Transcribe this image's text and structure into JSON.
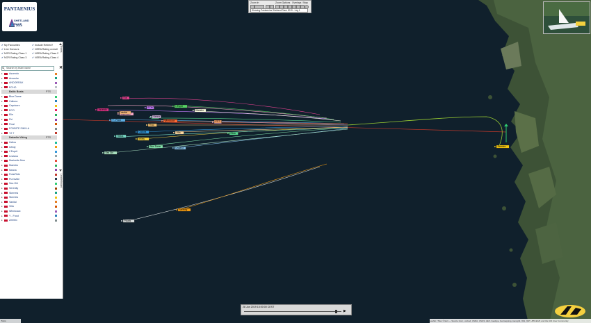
{
  "logo": {
    "brand": "PANTAENIUS",
    "event": "SHETLAND RACE",
    "year": "2019"
  },
  "panel": {
    "options": [
      {
        "label": "My Favourites",
        "checked": true
      },
      {
        "label": "Include Retired?",
        "checked": true
      },
      {
        "label": "Line Honours",
        "checked": true
      },
      {
        "label": "NSRA Rating overall",
        "checked": true
      },
      {
        "label": "NOR Rating Class 1",
        "checked": true
      },
      {
        "label": "NSRA Rating Class 2",
        "checked": true
      },
      {
        "label": "NOR Rating Class 3",
        "checked": true
      },
      {
        "label": "NSRA Rating Class 4",
        "checked": true
      }
    ],
    "search_placeholder": "Search by team name",
    "rows": [
      {
        "name": "Ascendo",
        "group": false,
        "color": "#e67e22"
      },
      {
        "name": "Annecke",
        "group": false,
        "color": "#16a085"
      },
      {
        "name": "ANDORRAX",
        "group": false,
        "color": "#9b59b6"
      },
      {
        "name": "ECHO",
        "group": false,
        "color": "#bdc3c7"
      },
      {
        "name": "Baltic Boats",
        "group": true,
        "pts": "PTS"
      },
      {
        "name": "Blue Dame",
        "group": false,
        "color": "#2ecc71"
      },
      {
        "name": "Calluna",
        "group": false,
        "color": "#2980b9"
      },
      {
        "name": "Capricorn",
        "group": false,
        "color": "#f1c40f"
      },
      {
        "name": "ECO",
        "group": false,
        "color": "#e91e63"
      },
      {
        "name": "Elie",
        "group": false,
        "color": "#27ae60"
      },
      {
        "name": "Firi",
        "group": false,
        "color": "#8e44ad"
      },
      {
        "name": "Final",
        "group": false,
        "color": "#d35400"
      },
      {
        "name": "FOXBITE SIMI LA",
        "group": false,
        "color": "#7f8c8d"
      },
      {
        "name": "Y2 7",
        "group": false,
        "color": "#c0392b"
      },
      {
        "name": "Dakarlin Viking",
        "group": true,
        "pts": "PTS"
      },
      {
        "name": "Helios",
        "group": false,
        "color": "#1abc9c"
      },
      {
        "name": "Infinty",
        "group": false,
        "color": "#f39c12"
      },
      {
        "name": "L'Esprit",
        "group": false,
        "color": "#3498db"
      },
      {
        "name": "Lealana",
        "group": false,
        "color": "#95a5a6"
      },
      {
        "name": "Marinette Mon",
        "group": false,
        "color": "#e74c3c"
      },
      {
        "name": "Maestro",
        "group": false,
        "color": "#27ae60"
      },
      {
        "name": "Nanna",
        "group": false,
        "color": "#8e44ad"
      },
      {
        "name": "PolarRide",
        "group": false,
        "color": "#c0392b"
      },
      {
        "name": "Purrsvide",
        "group": false,
        "color": "#2c3e50"
      },
      {
        "name": "Sea Girl",
        "group": false,
        "color": "#2ecc71"
      },
      {
        "name": "Serenity",
        "group": false,
        "color": "#a04000"
      },
      {
        "name": "Skerreis",
        "group": false,
        "color": "#16a085"
      },
      {
        "name": "Skerries",
        "group": false,
        "color": "#f1c40f"
      },
      {
        "name": "Vanilal",
        "group": false,
        "color": "#e67e22"
      },
      {
        "name": "Villa",
        "group": false,
        "color": "#d35400"
      },
      {
        "name": "Winnicaux",
        "group": false,
        "color": "#9b59b6"
      },
      {
        "name": "Y - Frost",
        "group": false,
        "color": "#2980b9"
      },
      {
        "name": "Zerfelix",
        "group": false,
        "color": "#7f8c8d"
      }
    ],
    "tab_teams": "Teams",
    "tab_leaderboard": "Leaderboard"
  },
  "toolbar": {
    "zoom_label": "Zoom In",
    "zoom_options": "Zoom Options",
    "overlays": "Overlays / Map",
    "view_select": "Showing Pantaenius Shetland Race 2019 - Leg 1"
  },
  "timebar": {
    "datetime": "28 Jun 2019 15:00:00 CEST"
  },
  "scale": "5 km",
  "attribution": "Leaflet | Tiles © Esri — Source: Esri, i-cubed, USDA, USGS, AEX, GeoEye, Getmapping, Aerogrid, IGN, IGP, UPR-EGP, and the GIS User Community",
  "boats": [
    {
      "label": "Eos",
      "color": "#e84393"
    },
    {
      "label": "Ascendo",
      "color": "#d63384"
    },
    {
      "label": "Capricorn",
      "color": "#f7a8c8"
    },
    {
      "label": "ECHO",
      "color": "#c77dff"
    },
    {
      "label": "L'Esprit",
      "color": "#56d364"
    },
    {
      "label": "Maestro",
      "color": "#f5f5dc"
    },
    {
      "label": "Elie",
      "color": "#58d68d"
    },
    {
      "label": "Y - Frost",
      "color": "#5dade2"
    },
    {
      "label": "Winnicaux",
      "color": "#ff6b35"
    },
    {
      "label": "Final",
      "color": "#f8c471"
    },
    {
      "label": "Firi",
      "color": "#c39bd3"
    },
    {
      "label": "Calluna",
      "color": "#3498db"
    },
    {
      "label": "Infinty",
      "color": "#f4d03f"
    },
    {
      "label": "Villa",
      "color": "#fad7a0"
    },
    {
      "label": "Blue Dame",
      "color": "#82e0aa"
    },
    {
      "label": "Lealana",
      "color": "#85c1e9"
    },
    {
      "label": "Sea Girl",
      "color": "#a9dfbf"
    },
    {
      "label": "Helios",
      "color": "#76d7c4"
    },
    {
      "label": "Nanna",
      "color": "#d2b4de"
    },
    {
      "label": "Skerries",
      "color": "#f1c40f"
    },
    {
      "label": "Y2 7",
      "color": "#e59866"
    },
    {
      "label": "Vanilal",
      "color": "#f0b27a"
    },
    {
      "label": "Serenity",
      "color": "#f39c12"
    },
    {
      "label": "Polaris",
      "color": "#d5dbdb"
    },
    {
      "label": "Elida",
      "color": "#58d68d"
    }
  ]
}
